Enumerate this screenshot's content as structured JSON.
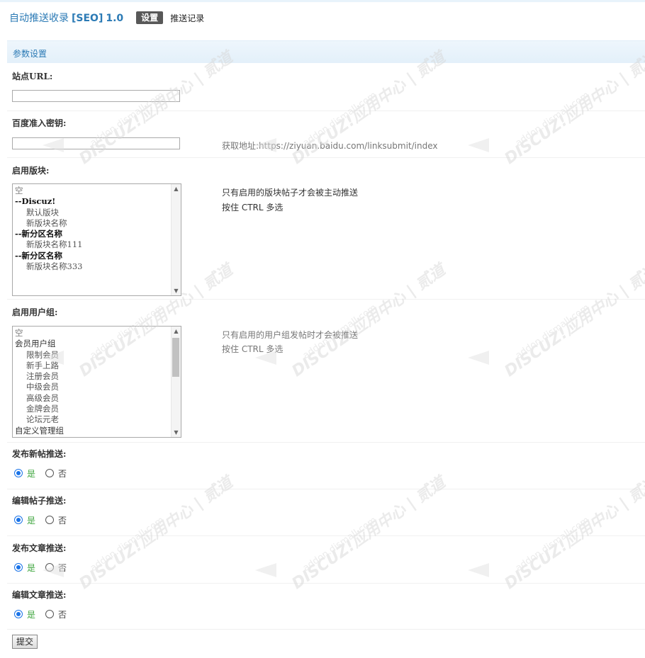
{
  "header": {
    "app_name": "自动推送收录",
    "app_tag": "[SEO]",
    "app_version": "1.0",
    "tab_active": "设置",
    "tab_other": "推送记录"
  },
  "section": {
    "title": "参数设置"
  },
  "fields": {
    "site_url": {
      "label": "站点URL:",
      "value": ""
    },
    "baidu_key": {
      "label": "百度准入密钥:",
      "value": "",
      "tip_prefix": "获取地址:",
      "tip_url": "https://ziyuan.baidu.com/linksubmit/index"
    },
    "forums": {
      "label": "启用版块:",
      "tip1": "只有启用的版块帖子才会被主动推送",
      "tip2": "按住 CTRL 多选",
      "options": [
        {
          "text": "空",
          "kind": "empty"
        },
        {
          "text": "--Discuz!",
          "kind": "grp"
        },
        {
          "text": "默认版块",
          "kind": "sub"
        },
        {
          "text": "新版块名称",
          "kind": "sub"
        },
        {
          "text": "--新分区名称",
          "kind": "grp"
        },
        {
          "text": "新版块名称111",
          "kind": "sub"
        },
        {
          "text": "--新分区名称",
          "kind": "grp"
        },
        {
          "text": "新版块名称333",
          "kind": "sub"
        }
      ]
    },
    "usergroups": {
      "label": "启用用户组:",
      "tip1": "只有启用的用户组发帖时才会被推送",
      "tip2": "按住 CTRL 多选",
      "options": [
        {
          "text": "空",
          "kind": "empty"
        },
        {
          "text": "会员用户组",
          "kind": "grpn"
        },
        {
          "text": "限制会员",
          "kind": "sub"
        },
        {
          "text": "新手上路",
          "kind": "sub"
        },
        {
          "text": "注册会员",
          "kind": "sub"
        },
        {
          "text": "中级会员",
          "kind": "sub"
        },
        {
          "text": "高级会员",
          "kind": "sub"
        },
        {
          "text": "金牌会员",
          "kind": "sub"
        },
        {
          "text": "论坛元老",
          "kind": "sub"
        },
        {
          "text": "自定义管理组",
          "kind": "grpn"
        }
      ]
    },
    "radios": [
      {
        "label": "发布新帖推送:",
        "yes": "是",
        "no": "否",
        "selected": "yes"
      },
      {
        "label": "编辑帖子推送:",
        "yes": "是",
        "no": "否",
        "selected": "yes"
      },
      {
        "label": "发布文章推送:",
        "yes": "是",
        "no": "否",
        "selected": "yes"
      },
      {
        "label": "编辑文章推送:",
        "yes": "是",
        "no": "否",
        "selected": "yes"
      }
    ]
  },
  "submit_label": "提交",
  "watermark": {
    "line1": "DISCUZ!应用中心 | 贰道",
    "line2": "addon.dismall.com"
  },
  "colors": {
    "accent": "#2b7ab5",
    "section_bg": "#e8f3fb",
    "radio_on": "#1a73e8",
    "yes_text": "#3fa63f"
  }
}
